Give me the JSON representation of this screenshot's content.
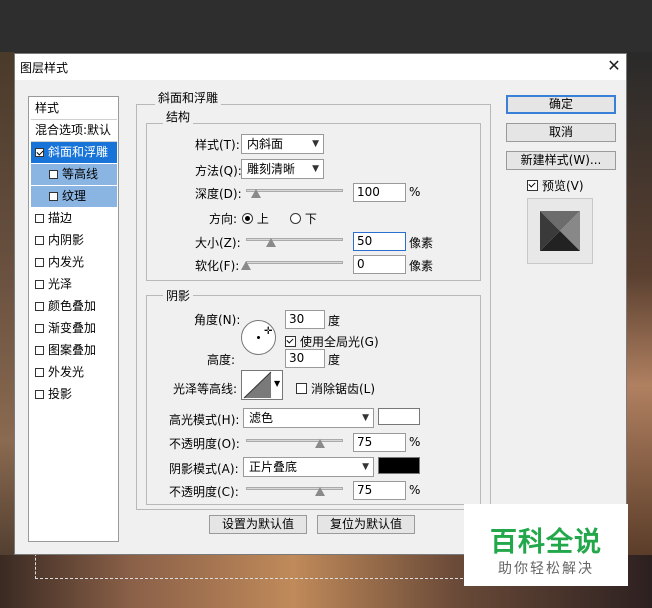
{
  "dialog": {
    "title": "图层样式"
  },
  "styles_list": {
    "header": "样式",
    "blend_options": "混合选项:默认",
    "items": [
      {
        "label": "斜面和浮雕",
        "checked": true
      },
      {
        "label": "等高线",
        "checked": false
      },
      {
        "label": "纹理",
        "checked": false
      },
      {
        "label": "描边",
        "checked": false
      },
      {
        "label": "内阴影",
        "checked": false
      },
      {
        "label": "内发光",
        "checked": false
      },
      {
        "label": "光泽",
        "checked": false
      },
      {
        "label": "颜色叠加",
        "checked": false
      },
      {
        "label": "渐变叠加",
        "checked": false
      },
      {
        "label": "图案叠加",
        "checked": false
      },
      {
        "label": "外发光",
        "checked": false
      },
      {
        "label": "投影",
        "checked": false
      }
    ]
  },
  "bevel": {
    "group_title": "斜面和浮雕",
    "structure": {
      "title": "结构",
      "style_label": "样式(T):",
      "style_value": "内斜面",
      "technique_label": "方法(Q):",
      "technique_value": "雕刻清晰",
      "depth_label": "深度(D):",
      "depth_value": "100",
      "depth_unit": "%",
      "direction_label": "方向:",
      "direction_up": "上",
      "direction_down": "下",
      "size_label": "大小(Z):",
      "size_value": "50",
      "size_unit": "像素",
      "soften_label": "软化(F):",
      "soften_value": "0",
      "soften_unit": "像素"
    },
    "shading": {
      "title": "阴影",
      "angle_label": "角度(N):",
      "angle_value": "30",
      "angle_unit": "度",
      "global_light_label": "使用全局光(G)",
      "altitude_label": "高度:",
      "altitude_value": "30",
      "altitude_unit": "度",
      "gloss_contour_label": "光泽等高线:",
      "anti_aliased_label": "消除锯齿(L)",
      "highlight_mode_label": "高光模式(H):",
      "highlight_mode_value": "滤色",
      "highlight_color": "#ffffff",
      "highlight_opacity_label": "不透明度(O):",
      "highlight_opacity_value": "75",
      "highlight_opacity_unit": "%",
      "shadow_mode_label": "阴影模式(A):",
      "shadow_mode_value": "正片叠底",
      "shadow_color": "#000000",
      "shadow_opacity_label": "不透明度(C):",
      "shadow_opacity_value": "75",
      "shadow_opacity_unit": "%"
    },
    "make_default": "设置为默认值",
    "reset_default": "复位为默认值"
  },
  "buttons": {
    "ok": "确定",
    "cancel": "取消",
    "new_style": "新建样式(W)...",
    "preview": "预览(V)"
  },
  "watermark": {
    "main": "百科全说",
    "sub": "助你轻松解决"
  },
  "colors": {
    "selection": "#1874d8",
    "watermark_green": "#22a84a"
  }
}
